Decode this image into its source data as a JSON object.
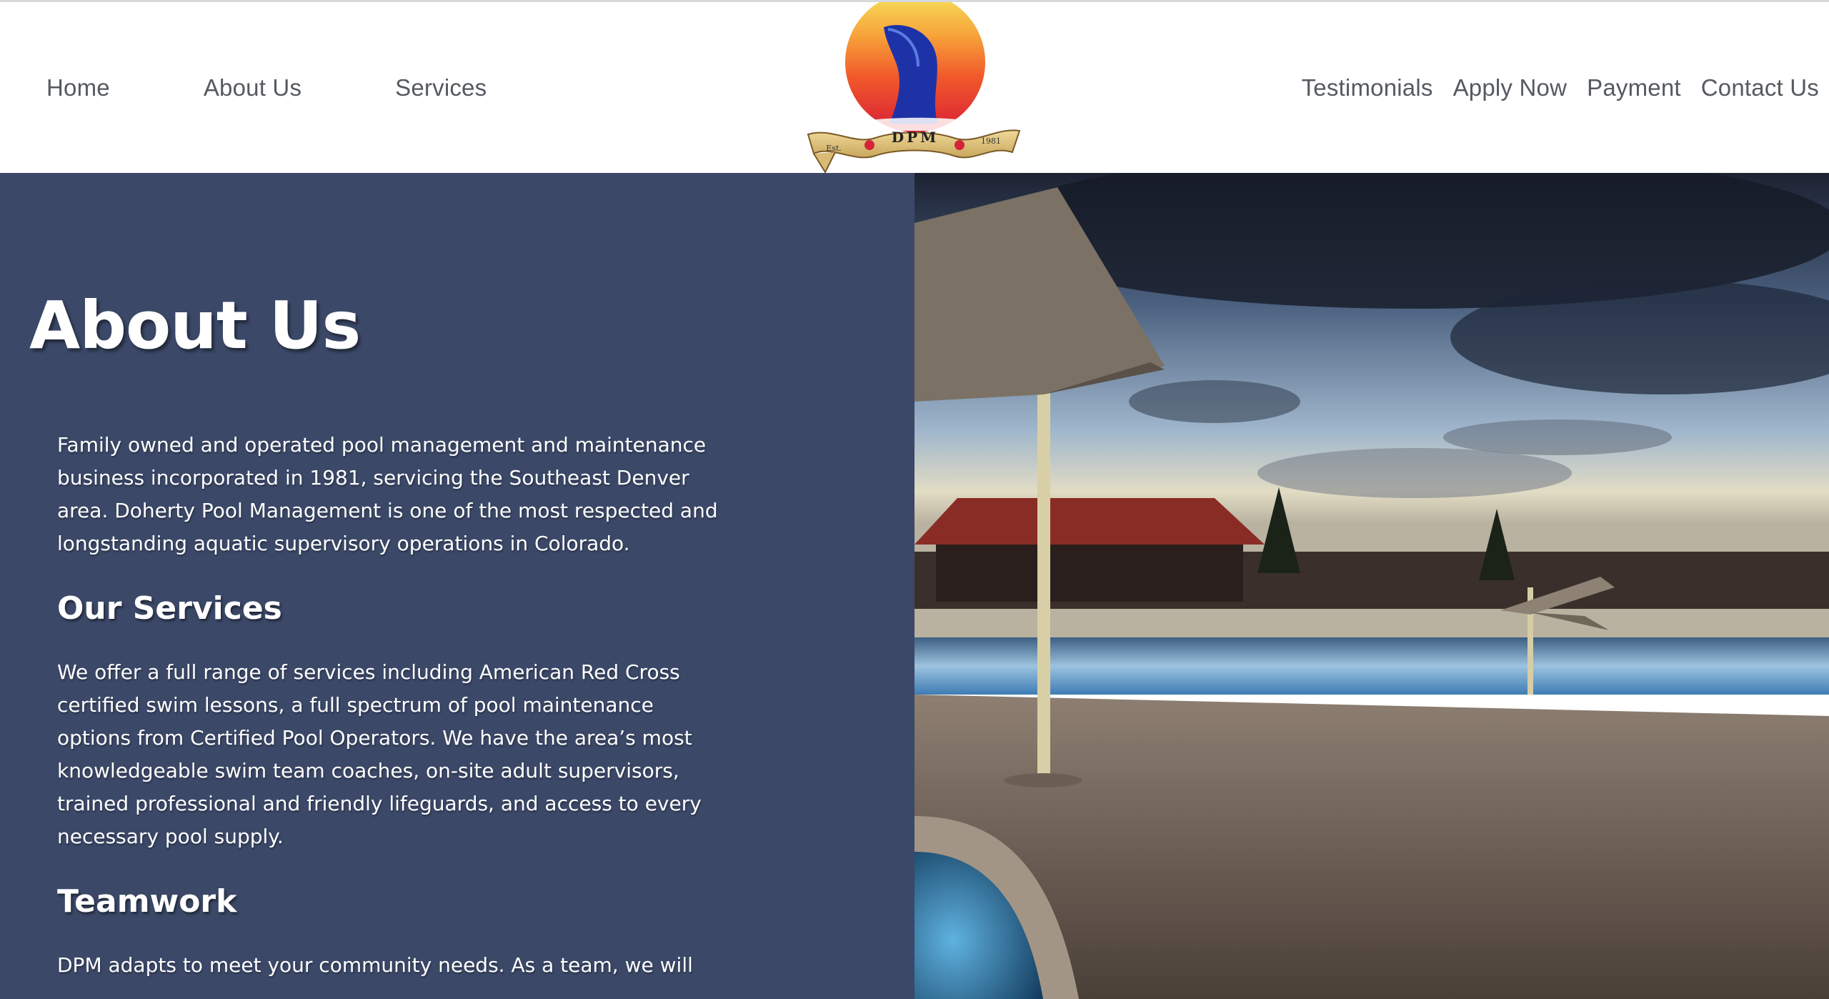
{
  "nav": {
    "left": [
      {
        "label": "Home"
      },
      {
        "label": "About Us"
      },
      {
        "label": "Services"
      }
    ],
    "right": [
      {
        "label": "Testimonials"
      },
      {
        "label": "Apply Now"
      },
      {
        "label": "Payment"
      },
      {
        "label": "Contact Us"
      }
    ]
  },
  "logo": {
    "banner_text": "DPM",
    "left_text": "Est.",
    "right_text": "1981"
  },
  "main": {
    "title": "About Us",
    "intro": "Family owned and operated pool management and maintenance business incorporated in 1981, servicing the Southeast Denver area. Doherty Pool Management is one of the most respected and longstanding aquatic supervisory operations in Colorado.",
    "services_heading": "Our Services",
    "services_text": "We offer a full range of services including American Red Cross certified swim lessons, a full spectrum of pool maintenance options from Certified Pool Operators. We have the area’s most knowledgeable swim team coaches, on-site adult supervisors, trained professional and friendly lifeguards, and access to every necessary pool supply.",
    "teamwork_heading": "Teamwork",
    "teamwork_text": "DPM adapts to meet your community needs. As a team, we will"
  },
  "colors": {
    "panel": "#3b4868",
    "nav_text": "#555a60"
  }
}
